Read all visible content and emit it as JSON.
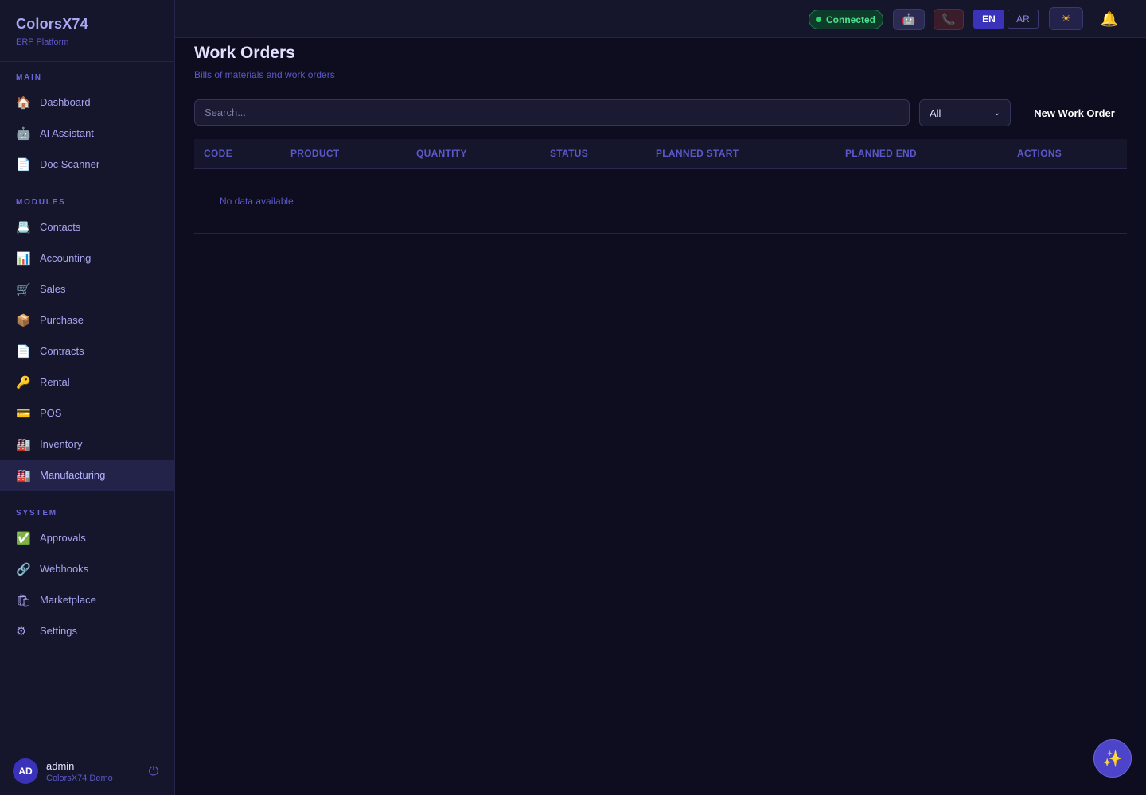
{
  "brand": {
    "name": "ColorsX74",
    "subtitle": "ERP Platform"
  },
  "sidebar": {
    "sections": [
      {
        "label": "MAIN",
        "items": [
          {
            "label": "Dashboard",
            "icon": "house-icon",
            "glyph": "🏠"
          },
          {
            "label": "AI Assistant",
            "icon": "robot-icon",
            "glyph": "🤖"
          },
          {
            "label": "Doc Scanner",
            "icon": "document-icon",
            "glyph": "📄"
          }
        ]
      },
      {
        "label": "MODULES",
        "items": [
          {
            "label": "Contacts",
            "icon": "contacts-icon",
            "glyph": "📇"
          },
          {
            "label": "Accounting",
            "icon": "chart-icon",
            "glyph": "📊"
          },
          {
            "label": "Sales",
            "icon": "cart-icon",
            "glyph": "🛒"
          },
          {
            "label": "Purchase",
            "icon": "package-icon",
            "glyph": "📦"
          },
          {
            "label": "Contracts",
            "icon": "document-icon",
            "glyph": "📄"
          },
          {
            "label": "Rental",
            "icon": "key-icon",
            "glyph": "🔑"
          },
          {
            "label": "POS",
            "icon": "card-icon",
            "glyph": "💳"
          },
          {
            "label": "Inventory",
            "icon": "factory-icon",
            "glyph": "🏭"
          },
          {
            "label": "Manufacturing",
            "icon": "factory-icon",
            "glyph": "🏭",
            "active": true
          }
        ]
      },
      {
        "label": "SYSTEM",
        "items": [
          {
            "label": "Approvals",
            "icon": "check-icon",
            "glyph": "✅"
          },
          {
            "label": "Webhooks",
            "icon": "link-icon",
            "glyph": "🔗"
          },
          {
            "label": "Marketplace",
            "icon": "shopping-bags-icon",
            "glyph": "🛍"
          },
          {
            "label": "Settings",
            "icon": "gear-icon",
            "glyph": "⚙"
          }
        ]
      }
    ]
  },
  "user": {
    "initials": "AD",
    "name": "admin",
    "org": "ColorsX74 Demo"
  },
  "topbar": {
    "connection": "Connected",
    "lang_en": "EN",
    "lang_ar": "AR",
    "icons": {
      "robot": "🤖",
      "phone": "📞",
      "theme": "☀",
      "bell": "🔔",
      "logout": "⏻",
      "fab": "✨"
    }
  },
  "page": {
    "title": "Work Orders",
    "subtitle": "Bills of materials and work orders",
    "search_placeholder": "Search...",
    "filter_value": "All",
    "new_button": "New Work Order"
  },
  "table": {
    "columns": [
      "CODE",
      "PRODUCT",
      "QUANTITY",
      "STATUS",
      "PLANNED START",
      "PLANNED END",
      "ACTIONS"
    ],
    "rows": [],
    "empty_text": "No data available"
  },
  "colors": {
    "accent": "#3a32b8",
    "background": "#0d0d1f",
    "sidebar": "#15152b",
    "success": "#4ee38e"
  }
}
